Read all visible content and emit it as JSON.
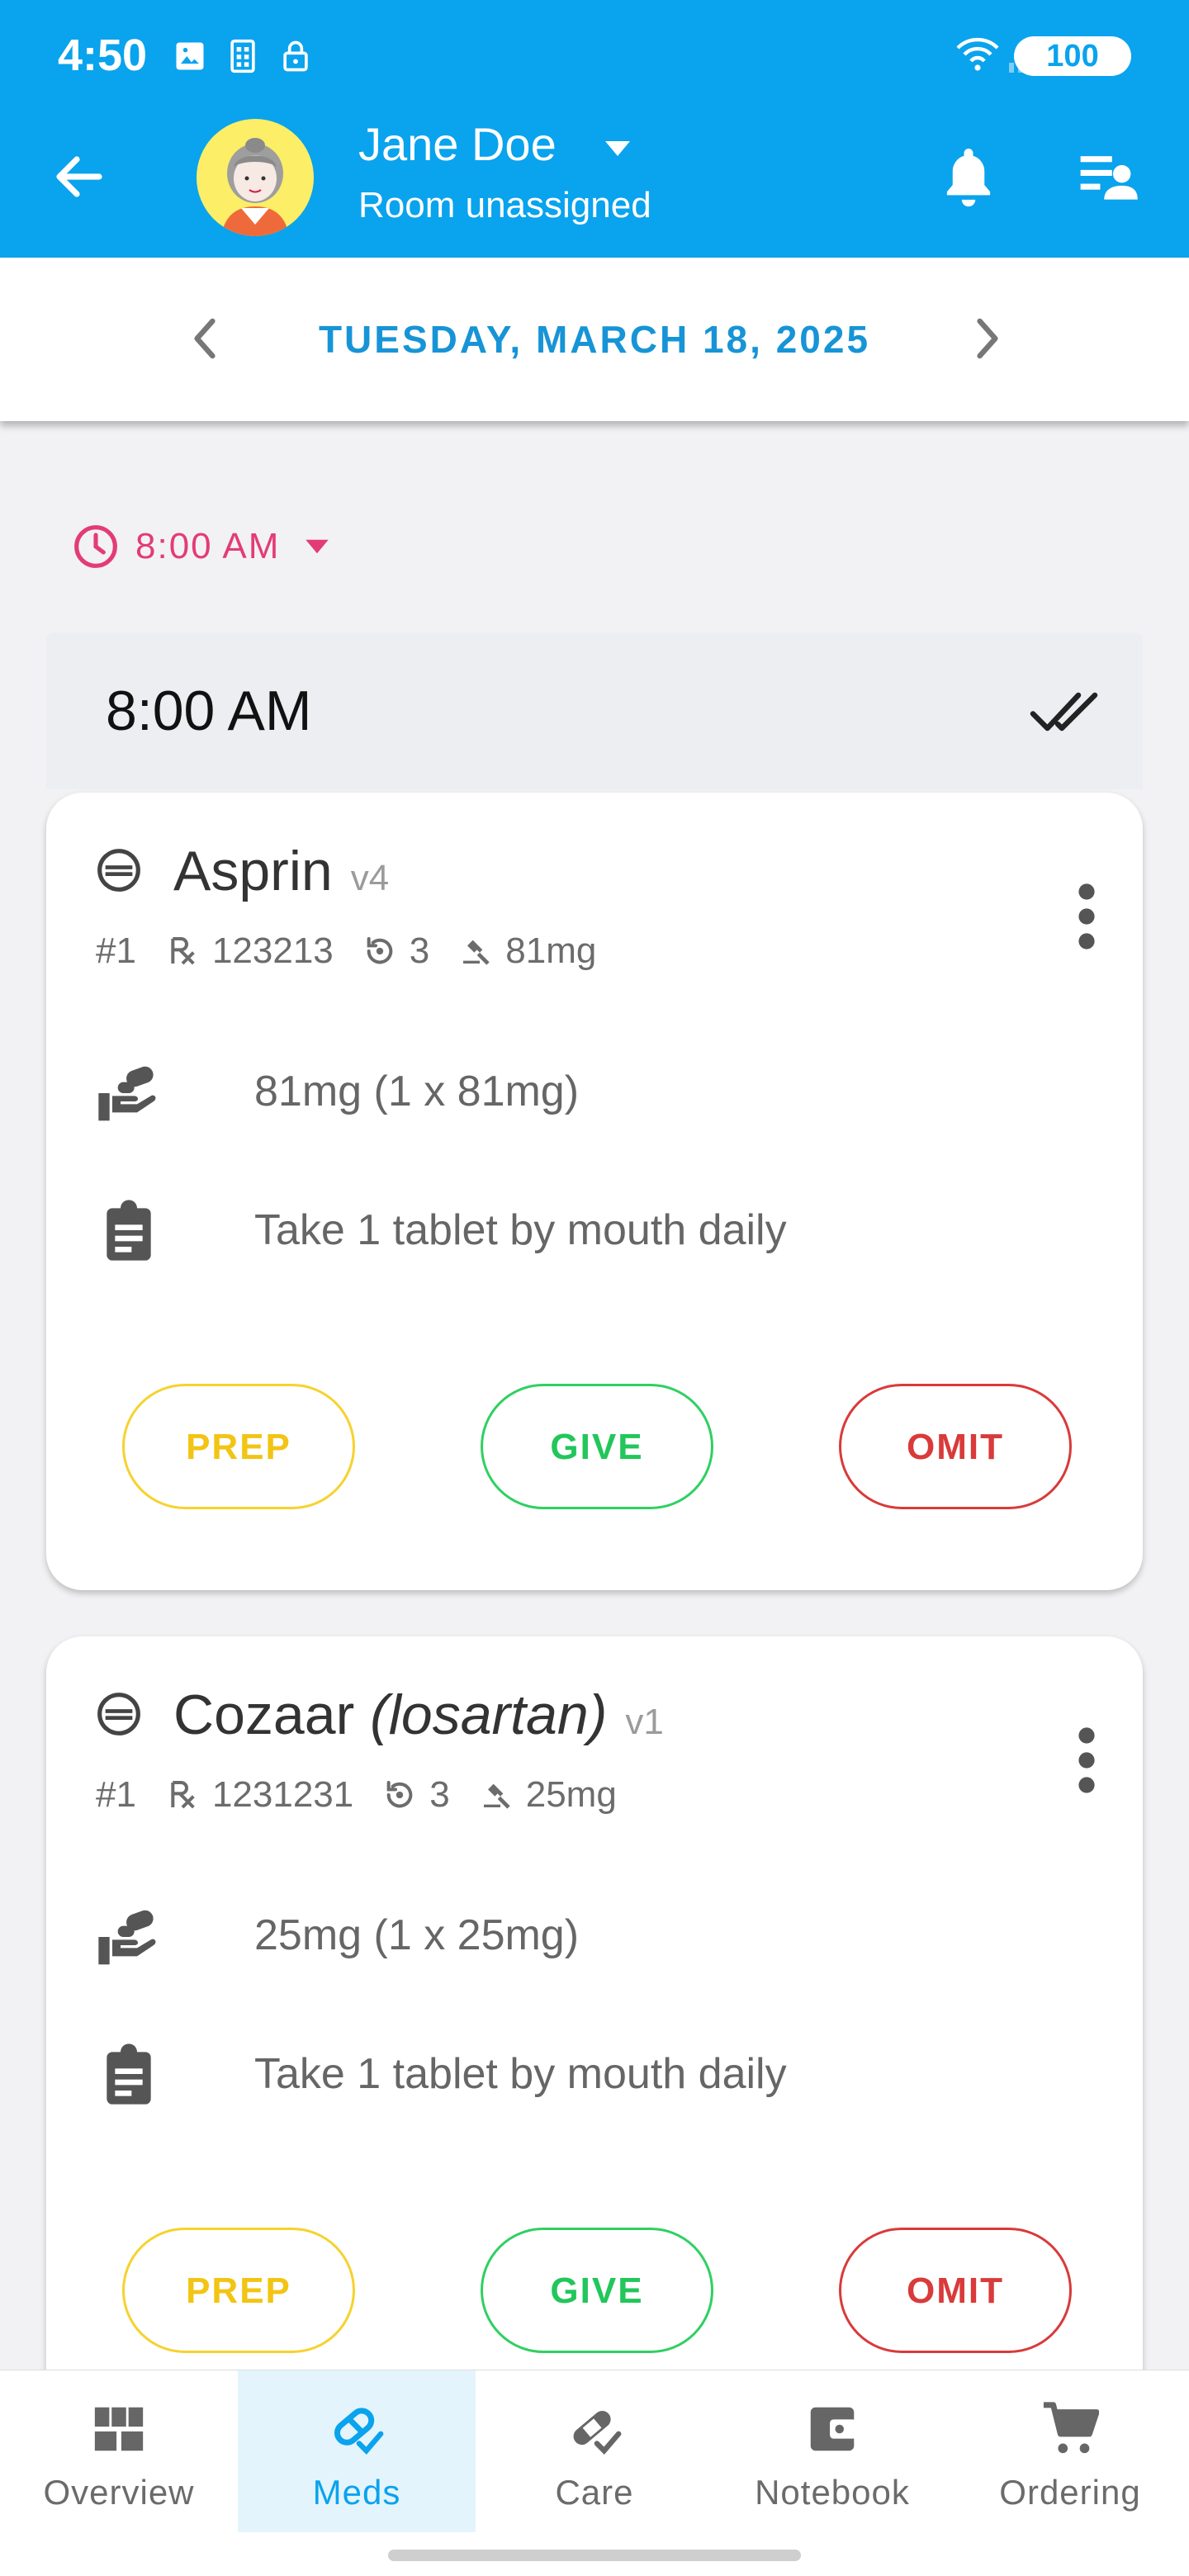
{
  "status_bar": {
    "time": "4:50",
    "battery": "100"
  },
  "header": {
    "patient_name": "Jane Doe",
    "room": "Room unassigned"
  },
  "date_nav": {
    "date": "TUESDAY, MARCH 18, 2025"
  },
  "time_filter": {
    "label": "8:00 AM"
  },
  "group": {
    "time": "8:00 AM"
  },
  "meds": [
    {
      "name": "Asprin",
      "generic": "",
      "version": "v4",
      "index": "#1",
      "rx": "123213",
      "refills": "3",
      "strength": "81mg",
      "dose": "81mg (1 x 81mg)",
      "instructions": "Take 1 tablet by mouth daily"
    },
    {
      "name": "Cozaar",
      "generic": "(losartan)",
      "version": "v1",
      "index": "#1",
      "rx": "1231231",
      "refills": "3",
      "strength": "25mg",
      "dose": "25mg (1 x 25mg)",
      "instructions": "Take 1 tablet by mouth daily"
    }
  ],
  "actions": {
    "prep": "PREP",
    "give": "GIVE",
    "omit": "OMIT"
  },
  "bottom_nav": [
    {
      "label": "Overview",
      "icon": "dashboard-icon"
    },
    {
      "label": "Meds",
      "icon": "pill-check-icon",
      "active": true
    },
    {
      "label": "Care",
      "icon": "bandage-check-icon"
    },
    {
      "label": "Notebook",
      "icon": "wallet-icon"
    },
    {
      "label": "Ordering",
      "icon": "cart-icon"
    }
  ],
  "colors": {
    "primary": "#0aa3ed",
    "time_accent": "#e33c74",
    "prep": "#f2c414",
    "give": "#22c65a",
    "omit": "#d93a3a"
  }
}
